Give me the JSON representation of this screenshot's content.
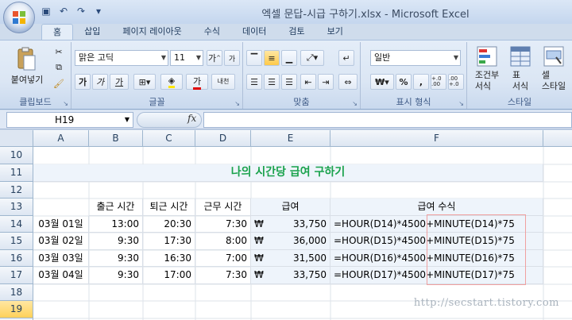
{
  "title_bar": {
    "title": "엑셀 문답-시급 구하기.xlsx - Microsoft Excel",
    "qat_icons": [
      "save-icon",
      "undo-icon",
      "redo-icon",
      "customize-icon"
    ]
  },
  "tabs": [
    "홈",
    "삽입",
    "페이지 레이아웃",
    "수식",
    "데이터",
    "검토",
    "보기"
  ],
  "ribbon": {
    "clipboard": {
      "label": "클립보드",
      "paste": "붙여넣기"
    },
    "font": {
      "label": "글꼴",
      "font_name": "맑은 고딕",
      "font_size": "11",
      "bold": "가",
      "italic": "가",
      "underline": "가",
      "grow": "가",
      "shrink": "가",
      "color": "가",
      "phonetic": "내천"
    },
    "alignment": {
      "label": "맞춤"
    },
    "number": {
      "label": "표시 형식",
      "format": "일반",
      "currency": "₩",
      "percent": "%",
      "comma": ",",
      "inc_decimal": "+.0 .00",
      "dec_decimal": ".00 +.0"
    },
    "styles": {
      "label": "스타일",
      "conditional": "조건부\n서식",
      "table": "표\n서식",
      "cell": "셀\n스타일"
    }
  },
  "formula_bar": {
    "name_box": "H19",
    "fx": "fx",
    "formula": ""
  },
  "sheet": {
    "columns": [
      "A",
      "B",
      "C",
      "D",
      "E",
      "F"
    ],
    "rows": [
      "10",
      "11",
      "12",
      "13",
      "14",
      "15",
      "16",
      "17",
      "18",
      "19",
      "20"
    ],
    "title": "나의 시간당 급여 구하기",
    "headers": {
      "start": "출근 시간",
      "end": "퇴근 시간",
      "work": "근무 시간",
      "pay": "급여",
      "formula": "급여 수식"
    },
    "data": [
      {
        "date": "03월 01일",
        "start": "13:00",
        "end": "20:30",
        "work": "7:30",
        "cur": "₩",
        "pay": "33,750",
        "f1": "=HOUR(D14)*4500",
        "f2": "+MINUTE(D14)*75"
      },
      {
        "date": "03월 02일",
        "start": "9:30",
        "end": "17:30",
        "work": "8:00",
        "cur": "₩",
        "pay": "36,000",
        "f1": "=HOUR(D15)*4500",
        "f2": "+MINUTE(D15)*75"
      },
      {
        "date": "03월 03일",
        "start": "9:30",
        "end": "16:30",
        "work": "7:00",
        "cur": "₩",
        "pay": "31,500",
        "f1": "=HOUR(D16)*4500",
        "f2": "+MINUTE(D16)*75"
      },
      {
        "date": "03월 04일",
        "start": "9:30",
        "end": "17:00",
        "work": "7:30",
        "cur": "₩",
        "pay": "33,750",
        "f1": "=HOUR(D17)*4500",
        "f2": "+MINUTE(D17)*75"
      }
    ],
    "watermark": "http://secstart.tistory.com"
  }
}
